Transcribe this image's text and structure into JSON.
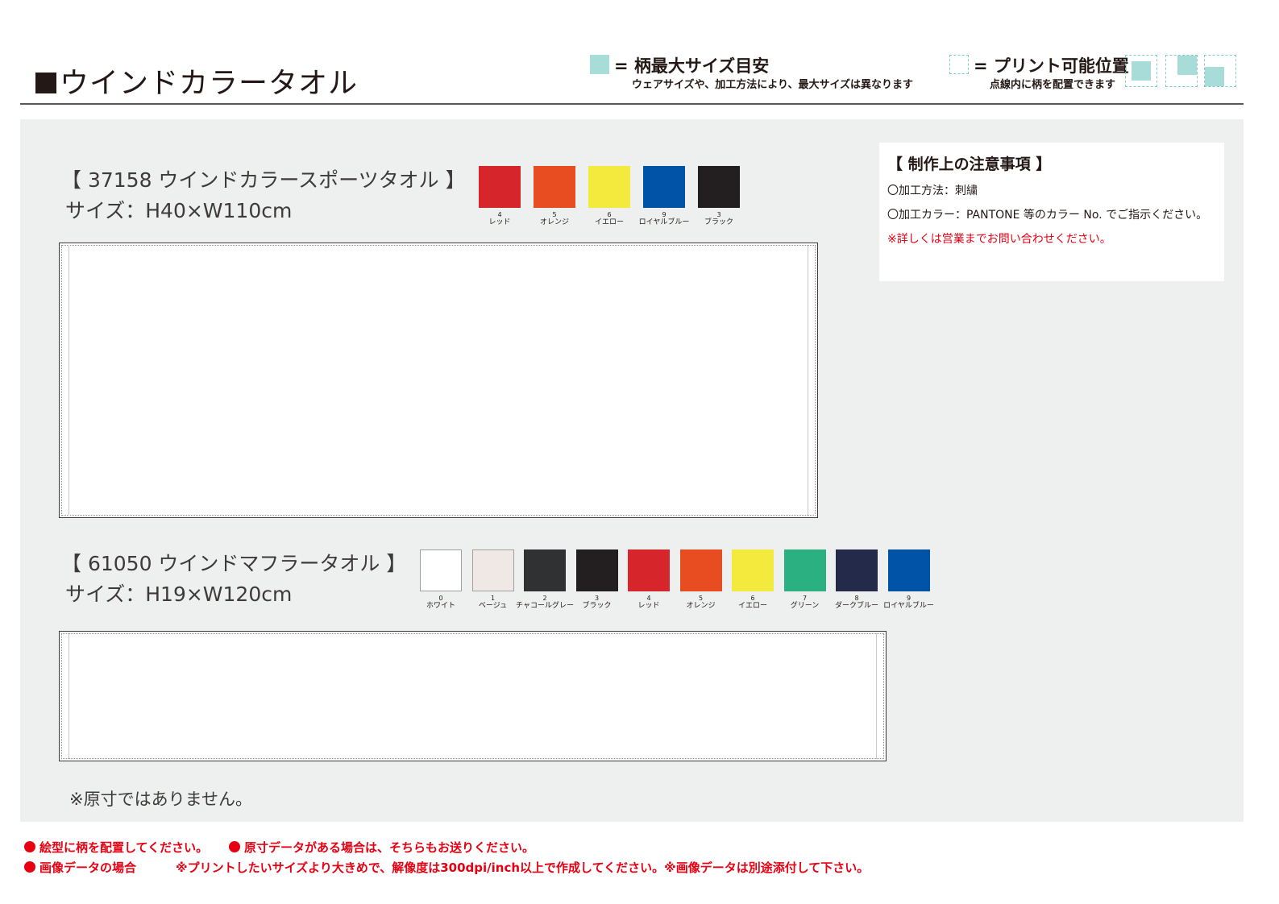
{
  "page": {
    "title": "ウインドカラータオル"
  },
  "legend": {
    "max_size_label": "= 柄最大サイズ目安",
    "max_size_note": "ウェアサイズや、加工方法により、最大サイズは異なります",
    "print_pos_label": "= プリント可能位置",
    "print_pos_note": "点線内に柄を配置できます"
  },
  "colors_theme": {
    "max_area": "#a8dcd9",
    "print_dashed": "#7fcac6",
    "panel_bg": "#eeefef",
    "warning_red": "#e60012"
  },
  "notes": {
    "title": "【 制作上の注意事項 】",
    "method": "〇加工方法：刺繍",
    "color": "〇加工カラー：PANTONE 等のカラー No. でご指示ください。",
    "warning": "※詳しくは営業までお問い合わせください。"
  },
  "products": [
    {
      "title": "【 37158 ウインドカラースポーツタオル 】",
      "size": "サイズ：H40×W110cm",
      "colors": [
        {
          "num": "4",
          "name": "レッド",
          "hex": "#d7262b"
        },
        {
          "num": "5",
          "name": "オレンジ",
          "hex": "#e84d22"
        },
        {
          "num": "6",
          "name": "イエロー",
          "hex": "#f3ea3d"
        },
        {
          "num": "9",
          "name": "ロイヤルブルー",
          "hex": "#0053a6"
        },
        {
          "num": "3",
          "name": "ブラック",
          "hex": "#231f20"
        }
      ]
    },
    {
      "title": "【 61050 ウインドマフラータオル 】",
      "size": "サイズ：H19×W120cm",
      "colors": [
        {
          "num": "0",
          "name": "ホワイト",
          "hex": "#ffffff"
        },
        {
          "num": "1",
          "name": "ベージュ",
          "hex": "#efe8e4"
        },
        {
          "num": "2",
          "name": "チャコールグレー",
          "hex": "#2f3132"
        },
        {
          "num": "3",
          "name": "ブラック",
          "hex": "#231f20"
        },
        {
          "num": "4",
          "name": "レッド",
          "hex": "#d7262b"
        },
        {
          "num": "5",
          "name": "オレンジ",
          "hex": "#e84d22"
        },
        {
          "num": "6",
          "name": "イエロー",
          "hex": "#f3ea3d"
        },
        {
          "num": "7",
          "name": "グリーン",
          "hex": "#2bb082"
        },
        {
          "num": "8",
          "name": "ダークブルー",
          "hex": "#232a4a"
        },
        {
          "num": "9",
          "name": "ロイヤルブルー",
          "hex": "#0053a6"
        }
      ]
    }
  ],
  "not_actual_size": "※原寸ではありません。",
  "footer": {
    "line1_a": "絵型に柄を配置してください。",
    "line1_b": "原寸データがある場合は、そちらもお送りください。",
    "line2_a": "画像データの場合",
    "line2_b": "※プリントしたいサイズより大きめで、解像度は300dpi/inch以上で作成してください。※画像データは別途添付して下さい。"
  }
}
